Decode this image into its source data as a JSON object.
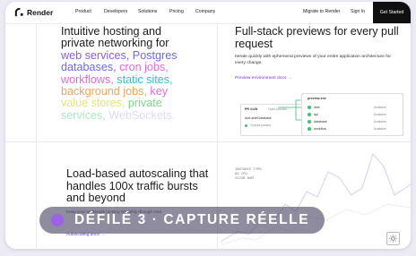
{
  "nav": {
    "logo": "Render",
    "links": [
      "Product",
      "Developers",
      "Solutions",
      "Pricing",
      "Company"
    ],
    "migrate": "Migrate to Render",
    "sign_in": "Sign In",
    "get_started": "Get Started"
  },
  "hero": {
    "line1": "Intuitive hosting and",
    "line2": "private networking for",
    "words": [
      "web services,",
      "Postgres",
      "databases,",
      "cron jobs,",
      "workflows,",
      "static sites,",
      "background jobs,",
      "key",
      "value stores,",
      "private",
      "services,",
      "WebSockets."
    ]
  },
  "previews": {
    "title": "Full-stack previews for every pull request",
    "description": "Iterate quickly with ephemeral previews of your entire application architecture for every change.",
    "link": "Preview environment docs →",
    "pr_card": {
      "id": "PR #128",
      "meta": "Open preview →",
      "check": "Add authDatabase",
      "status": "Checks passed"
    },
    "env_card": {
      "name": "preview-env",
      "rows": [
        {
          "name": "web",
          "status": "Available"
        },
        {
          "name": "api",
          "status": "Available"
        },
        {
          "name": "database",
          "status": "Available"
        },
        {
          "name": "workflow",
          "status": "Available"
        }
      ]
    }
  },
  "autoscaling": {
    "title": "Load-based autoscaling that handles 100x traffic bursts and beyond",
    "description": "Keep your workloads running smoothly through viral",
    "link": "Autoscaling docs →",
    "metrics": [
      "INSTANCE TYPE:",
      "8X CPU",
      "512GB RAM"
    ]
  },
  "overlay": {
    "text": "DÉFILÉ 3 · CAPTURE RÉELLE"
  },
  "colors": {
    "accent": "#8b5cf6",
    "link": "#6b34d7",
    "success": "#3fbf73"
  }
}
